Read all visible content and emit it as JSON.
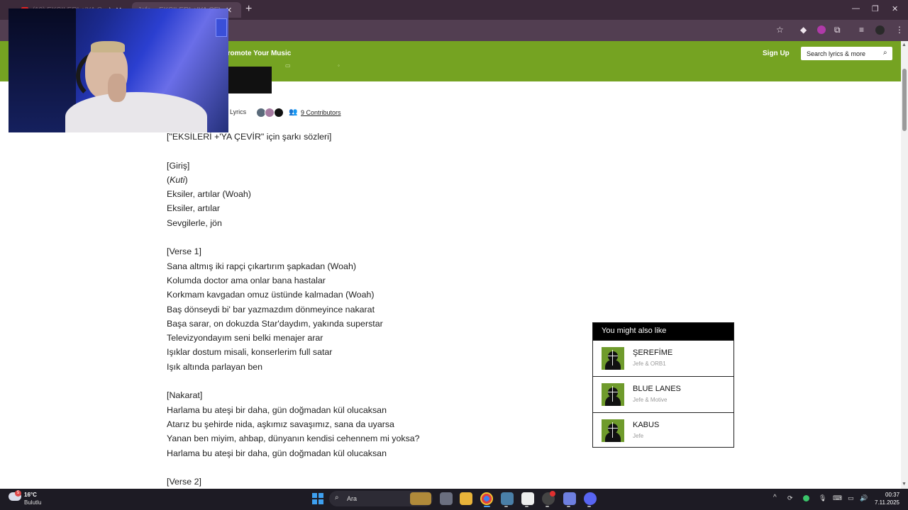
{
  "browser": {
    "tabs": [
      {
        "label": "(10) EKSİLERİ +'YA ÇEVİR",
        "active": false
      },
      {
        "label": "Jefe – EKSİLERİ +'YA ÇEVİR Lyrics",
        "active": true
      }
    ],
    "new_tab_icon": "+",
    "window_controls": [
      "—",
      "❐",
      "✕"
    ],
    "toolbar_icons": [
      "star-icon",
      "extension-icon",
      "profile-icon",
      "puzzle-icon",
      "tab-search-icon",
      "menu-icon"
    ]
  },
  "header": {
    "promote_label": "Promote Your Music",
    "signup_label": "Sign Up",
    "search_placeholder": "Search lyrics & more",
    "accent": "#75a322"
  },
  "song_meta": {
    "lyrics_label": "Lyrics",
    "contributors_label": "9 Contributors"
  },
  "lyrics": [
    "[\"EKSİLERİ +'YA ÇEVİR\" için şarkı sözleri]",
    "",
    "[Giriş]",
    "(Kuti)",
    "Eksiler, artılar (Woah)",
    "Eksiler, artılar",
    "Sevgilerle, jön",
    "",
    "[Verse 1]",
    "Sana altmış iki rapçi çıkartırım şapkadan (Woah)",
    "Kolumda doctor ama onlar bana hastalar",
    "Korkmam kavgadan omuz üstünde kalmadan (Woah)",
    "Baş dönseydi bi' bar yazmazdım dönmeyince nakarat",
    "Başa sarar, on dokuzda Star'daydım, yakında superstar",
    "Televizyondayım seni belki menajer arar",
    "Işıklar dostum misali, konserlerim full satar",
    "Işık altında parlayan ben",
    "",
    "[Nakarat]",
    "Harlama bu ateşi bir daha, gün doğmadan kül olucaksan",
    "Atarız bu şehirde nida, aşkımız savaşımız, sana da uyarsa",
    "Yanan ben miyim, ahbap, dünyanın kendisi cehennem mi yoksa?",
    "Harlama bu ateşi bir daha, gün doğmadan kül olucaksan",
    "",
    "[Verse 2]"
  ],
  "also_like": {
    "title": "You might also like",
    "songs": [
      {
        "title": "ŞEREFİME",
        "artist": "Jefe & ORB1"
      },
      {
        "title": "BLUE LANES",
        "artist": "Jefe & Motive"
      },
      {
        "title": "KABUS",
        "artist": "Jefe"
      }
    ]
  },
  "taskbar": {
    "weather_temp": "16°C",
    "weather_desc": "Bulutlu",
    "weather_badge": "5",
    "search_label": "Ara",
    "time": "00:37",
    "date": "7.11.2025"
  }
}
